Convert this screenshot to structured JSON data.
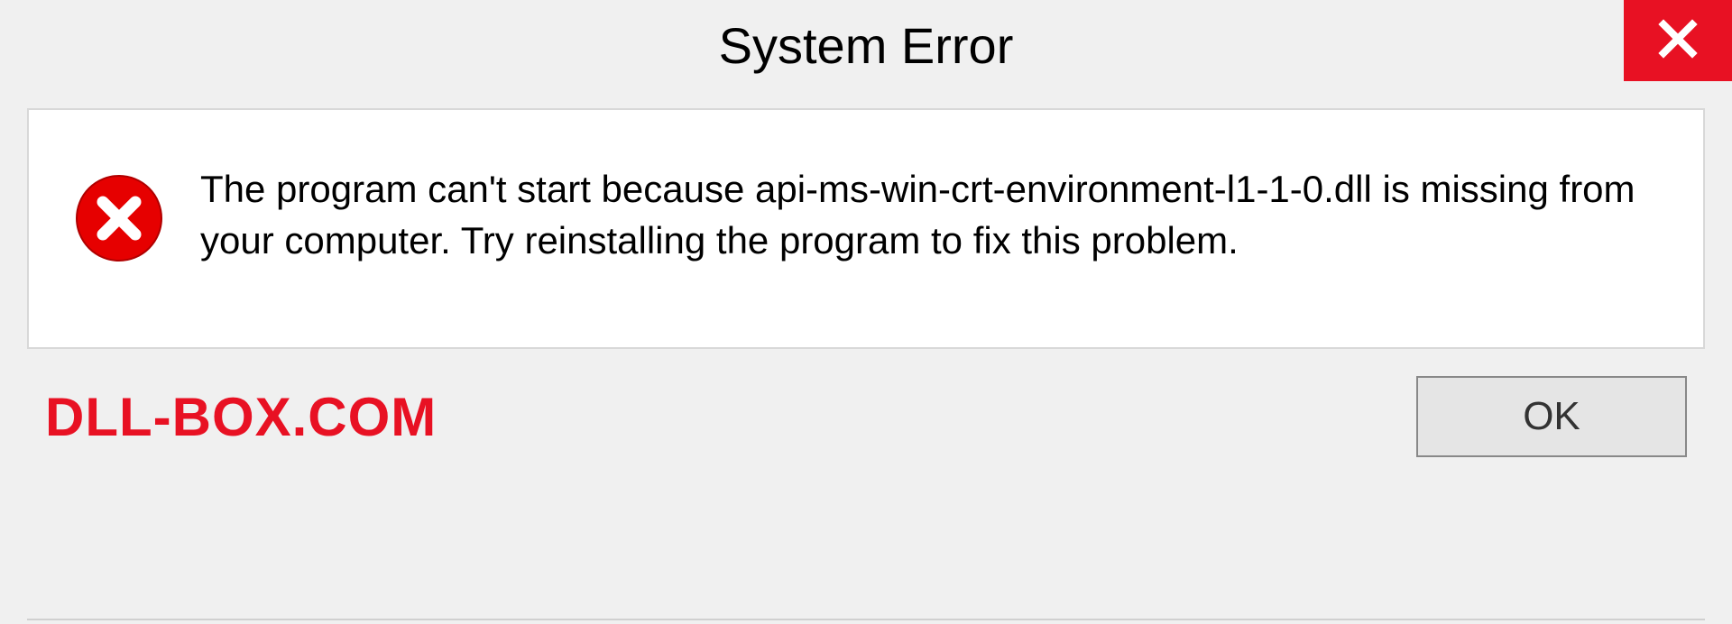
{
  "titlebar": {
    "title": "System Error"
  },
  "body": {
    "message": "The program can't start because api-ms-win-crt-environment-l1-1-0.dll is missing from your computer. Try reinstalling the program to fix this problem."
  },
  "footer": {
    "watermark": "DLL-BOX.COM",
    "ok_label": "OK"
  },
  "colors": {
    "accent_red": "#e81123"
  }
}
